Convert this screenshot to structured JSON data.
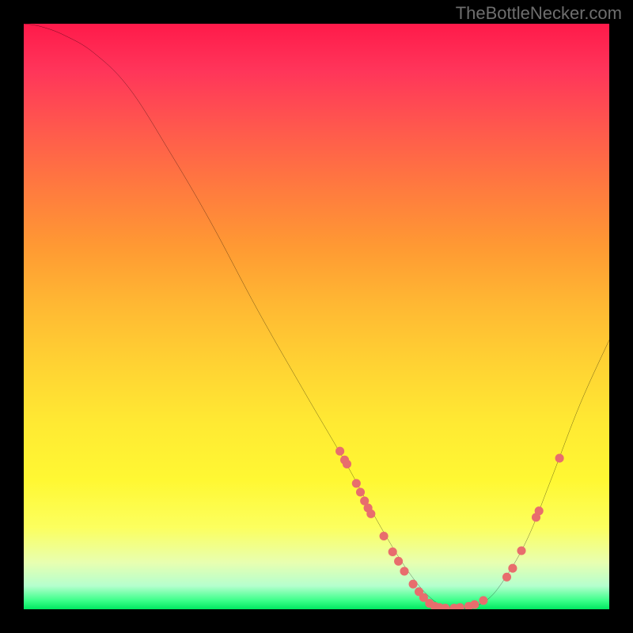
{
  "attribution": "TheBottleNecker.com",
  "chart_data": {
    "type": "line",
    "title": "",
    "xlabel": "",
    "ylabel": "",
    "xlim": [
      0,
      100
    ],
    "ylim": [
      0,
      100
    ],
    "curve": [
      {
        "x": 0,
        "y": 100
      },
      {
        "x": 3,
        "y": 99.5
      },
      {
        "x": 7,
        "y": 98
      },
      {
        "x": 12,
        "y": 95
      },
      {
        "x": 18,
        "y": 89
      },
      {
        "x": 25,
        "y": 78
      },
      {
        "x": 32,
        "y": 66
      },
      {
        "x": 40,
        "y": 51
      },
      {
        "x": 48,
        "y": 37
      },
      {
        "x": 55,
        "y": 25
      },
      {
        "x": 61,
        "y": 14
      },
      {
        "x": 66,
        "y": 6
      },
      {
        "x": 70,
        "y": 1.5
      },
      {
        "x": 73,
        "y": 0.3
      },
      {
        "x": 76,
        "y": 0.3
      },
      {
        "x": 79,
        "y": 1.5
      },
      {
        "x": 82,
        "y": 5
      },
      {
        "x": 86,
        "y": 12
      },
      {
        "x": 90,
        "y": 22
      },
      {
        "x": 95,
        "y": 35
      },
      {
        "x": 100,
        "y": 46
      }
    ],
    "marker_points": [
      {
        "x": 54.0,
        "y": 27.0
      },
      {
        "x": 54.8,
        "y": 25.5
      },
      {
        "x": 55.2,
        "y": 24.8
      },
      {
        "x": 56.8,
        "y": 21.5
      },
      {
        "x": 57.5,
        "y": 20.0
      },
      {
        "x": 58.2,
        "y": 18.5
      },
      {
        "x": 58.8,
        "y": 17.3
      },
      {
        "x": 59.3,
        "y": 16.3
      },
      {
        "x": 61.5,
        "y": 12.5
      },
      {
        "x": 63.0,
        "y": 9.8
      },
      {
        "x": 64.0,
        "y": 8.2
      },
      {
        "x": 65.0,
        "y": 6.5
      },
      {
        "x": 66.5,
        "y": 4.3
      },
      {
        "x": 67.5,
        "y": 3.0
      },
      {
        "x": 68.3,
        "y": 2.0
      },
      {
        "x": 69.3,
        "y": 1.0
      },
      {
        "x": 70.2,
        "y": 0.5
      },
      {
        "x": 71.0,
        "y": 0.3
      },
      {
        "x": 72.0,
        "y": 0.2
      },
      {
        "x": 73.5,
        "y": 0.2
      },
      {
        "x": 74.5,
        "y": 0.3
      },
      {
        "x": 76.0,
        "y": 0.5
      },
      {
        "x": 77.0,
        "y": 0.8
      },
      {
        "x": 78.5,
        "y": 1.5
      },
      {
        "x": 82.5,
        "y": 5.5
      },
      {
        "x": 83.5,
        "y": 7.0
      },
      {
        "x": 85.0,
        "y": 10.0
      },
      {
        "x": 87.5,
        "y": 15.7
      },
      {
        "x": 88.0,
        "y": 16.8
      },
      {
        "x": 91.5,
        "y": 25.8
      }
    ],
    "colors": {
      "line": "#000000",
      "marker": "#e86d6d",
      "top_gradient": "#ff1a4a",
      "bottom_gradient": "#00e860"
    }
  }
}
